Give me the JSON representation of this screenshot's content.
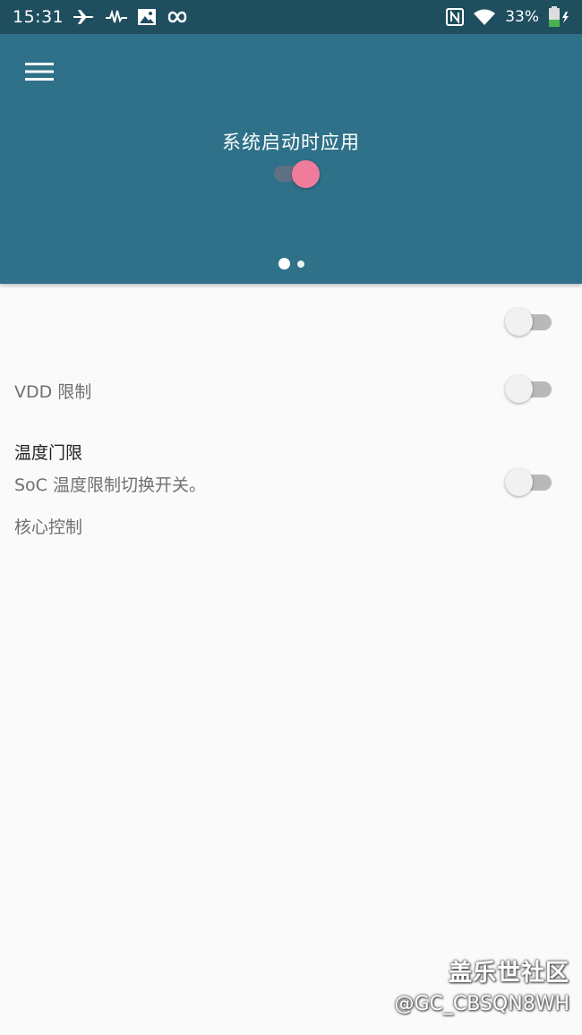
{
  "status_bar": {
    "time": "15:31",
    "battery_percent": "33%",
    "icons_left": [
      "airplane-icon",
      "pulse-icon",
      "image-icon",
      "infinity-icon"
    ],
    "icons_right": [
      "nfc-icon",
      "wifi-icon",
      "battery-charging-icon"
    ]
  },
  "header": {
    "title": "系统启动时应用",
    "apply_on_boot_enabled": true,
    "page_count": 2,
    "current_page": 1,
    "menu_icon": "hamburger-menu-icon"
  },
  "settings": [
    {
      "title": "核心控制",
      "summary": "",
      "enabled": false
    },
    {
      "title": "VDD 限制",
      "summary": "",
      "enabled": false
    },
    {
      "title": "温度门限",
      "summary": "SoC 温度限制切换开关。",
      "enabled": false
    }
  ],
  "watermark": {
    "brand": "盖乐世社区",
    "user": "@GC_CBSQN8WH"
  },
  "colors": {
    "status_bar": "#1f4e5f",
    "header": "#2e7189",
    "accent": "#ef7c9b",
    "background": "#fafafa"
  }
}
